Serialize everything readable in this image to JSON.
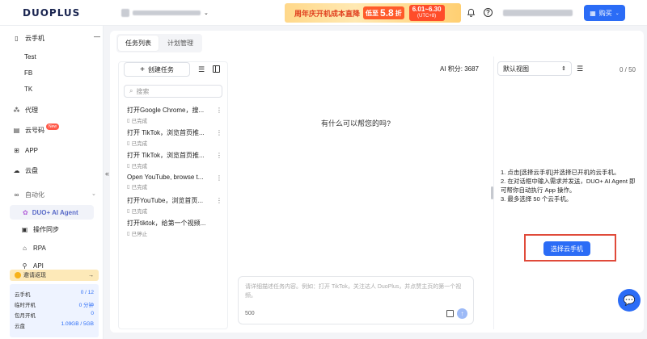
{
  "header": {
    "logo": "DUOPLUS",
    "promo": {
      "title": "周年庆开机成本直降",
      "label": "低至",
      "discount": "5.8",
      "discount_unit": "折",
      "date": "6.01~6.30",
      "timezone": "(UTC+8)"
    },
    "buy_label": "购买"
  },
  "sidebar": {
    "cloud_phone": "云手机",
    "sub_items": [
      "Test",
      "FB",
      "TK"
    ],
    "proxy": "代理",
    "cloud_number": "云号码",
    "new_badge": "New",
    "app": "APP",
    "cloud_disk": "云盘",
    "automation": "自动化",
    "ai_agent": "DUO+ AI Agent",
    "sync_operation": "操作同步",
    "rpa": "RPA",
    "api": "API",
    "invite": "邀请返现",
    "stats": [
      {
        "label": "云手机",
        "value": "0 / 12"
      },
      {
        "label": "临时开机",
        "value": "0 分钟"
      },
      {
        "label": "包月开机",
        "value": "0"
      },
      {
        "label": "云盘",
        "value": "1.09GB / 5GB"
      }
    ]
  },
  "main": {
    "tabs": [
      "任务列表",
      "计划管理"
    ],
    "create_task": "创建任务",
    "search_placeholder": "搜索",
    "tasks": [
      {
        "title": "打开Google Chrome，搜...",
        "status": "已完成"
      },
      {
        "title": "打开 TikTok，浏览首页推...",
        "status": "已完成"
      },
      {
        "title": "打开 TikTok，浏览首页推...",
        "status": "已完成"
      },
      {
        "title": "Open YouTube, browse t...",
        "status": "已完成"
      },
      {
        "title": "打开YouTube，浏览首页...",
        "status": "已完成"
      },
      {
        "title": "打开tiktok，给第一个视频...",
        "status": "已停止"
      }
    ],
    "ai_points": "AI 积分: 3687",
    "chat_prompt": "有什么可以帮您的吗?",
    "input_placeholder": "请详细描述任务内容。例如：打开 TikTok，关注达人 DuoPlus，并点赞主页的第一个视频。",
    "char_count": "500",
    "view_select": "默认视图",
    "phone_count": "0 / 50",
    "instructions": [
      "1. 点击[选择云手机]并选择已开机的云手机。",
      "2. 在对话框中输入需求并发送，DUO+ AI Agent 即可帮你自动执行 App 操作。",
      "3. 最多选择 50 个云手机。"
    ],
    "select_phone": "选择云手机"
  }
}
